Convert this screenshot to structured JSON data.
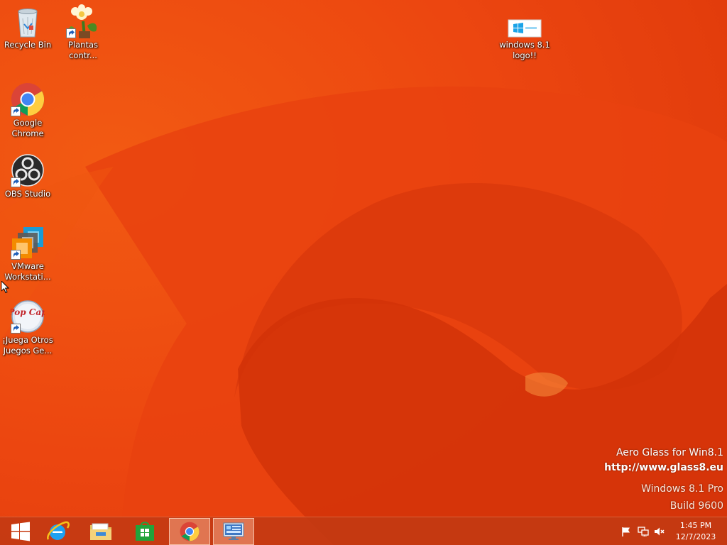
{
  "desktop": {
    "icons": [
      {
        "id": "recycle-bin",
        "label": "Recycle Bin"
      },
      {
        "id": "plantas",
        "label": "Plantas\ncontr..."
      },
      {
        "id": "chrome",
        "label": "Google\nChrome"
      },
      {
        "id": "obs",
        "label": "OBS Studio"
      },
      {
        "id": "vmware",
        "label": "VMware\nWorkstati..."
      },
      {
        "id": "popcap",
        "label": "¡Juega Otros\nJuegos Ge...",
        "logo_text": "Pop Cap"
      },
      {
        "id": "win81-logo-file",
        "label": "windows 8.1\nlogo!!"
      }
    ]
  },
  "watermark": {
    "line1": "Aero Glass for Win8.1",
    "line2": "http://www.glass8.eu",
    "line3": "Windows 8.1 Pro",
    "line4": "Build 9600"
  },
  "taskbar": {
    "items": [
      {
        "name": "start-button",
        "icon": "windows-logo-icon"
      },
      {
        "name": "internet-explorer",
        "icon": "ie-icon"
      },
      {
        "name": "file-explorer",
        "icon": "folder-icon"
      },
      {
        "name": "windows-store",
        "icon": "store-icon"
      },
      {
        "name": "google-chrome",
        "icon": "chrome-icon",
        "active": true
      },
      {
        "name": "remote-desktop",
        "icon": "monitor-icon",
        "active": true
      }
    ],
    "tray": [
      "action-center-flag-icon",
      "network-icon",
      "volume-muted-icon"
    ],
    "clock": {
      "time": "1:45 PM",
      "date": "12/7/2023"
    }
  },
  "colors": {
    "wallpaper": "#ec4a10",
    "taskbar": "#c33a12",
    "text": "#ffffff"
  }
}
